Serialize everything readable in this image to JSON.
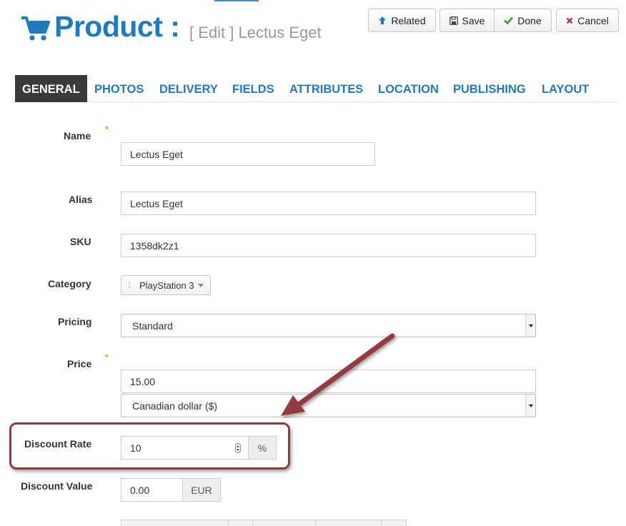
{
  "header": {
    "title": "Product :",
    "subtitle": "[ Edit ] Lectus Eget",
    "buttons": {
      "related": "Related",
      "save": "Save",
      "done": "Done",
      "cancel": "Cancel"
    }
  },
  "tabs": [
    {
      "label": "GENERAL",
      "active": true
    },
    {
      "label": "PHOTOS"
    },
    {
      "label": "DELIVERY"
    },
    {
      "label": "FIELDS"
    },
    {
      "label": "ATTRIBUTES"
    },
    {
      "label": "LOCATION"
    },
    {
      "label": "PUBLISHING"
    },
    {
      "label": "LAYOUT"
    }
  ],
  "form": {
    "name": {
      "label": "Name",
      "value": "Lectus Eget",
      "required_mark": "*"
    },
    "alias": {
      "label": "Alias",
      "value": "Lectus Eget"
    },
    "sku": {
      "label": "SKU",
      "value": "1358dk2z1"
    },
    "category": {
      "label": "Category",
      "value": "PlayStation 3"
    },
    "pricing": {
      "label": "Pricing",
      "value": "Standard"
    },
    "price": {
      "label": "Price",
      "value": "15.00",
      "currency": "Canadian dollar ($)",
      "required_mark": "*"
    },
    "discount_rate": {
      "label": "Discount Rate",
      "value": "10",
      "unit": "%"
    },
    "discount_value": {
      "label": "Discount Value",
      "value": "0.00",
      "unit": "EUR"
    }
  },
  "colors": {
    "brand": "#1f7bc0",
    "active_tab_bg": "#3a3a3a",
    "annotation": "#923b3f",
    "required": "#f0a000"
  },
  "icons": {
    "cart": "shopping-cart-icon",
    "related": "arrow-up-icon",
    "save": "floppy-disk-icon",
    "done": "checkmark-icon",
    "cancel": "x-icon"
  }
}
